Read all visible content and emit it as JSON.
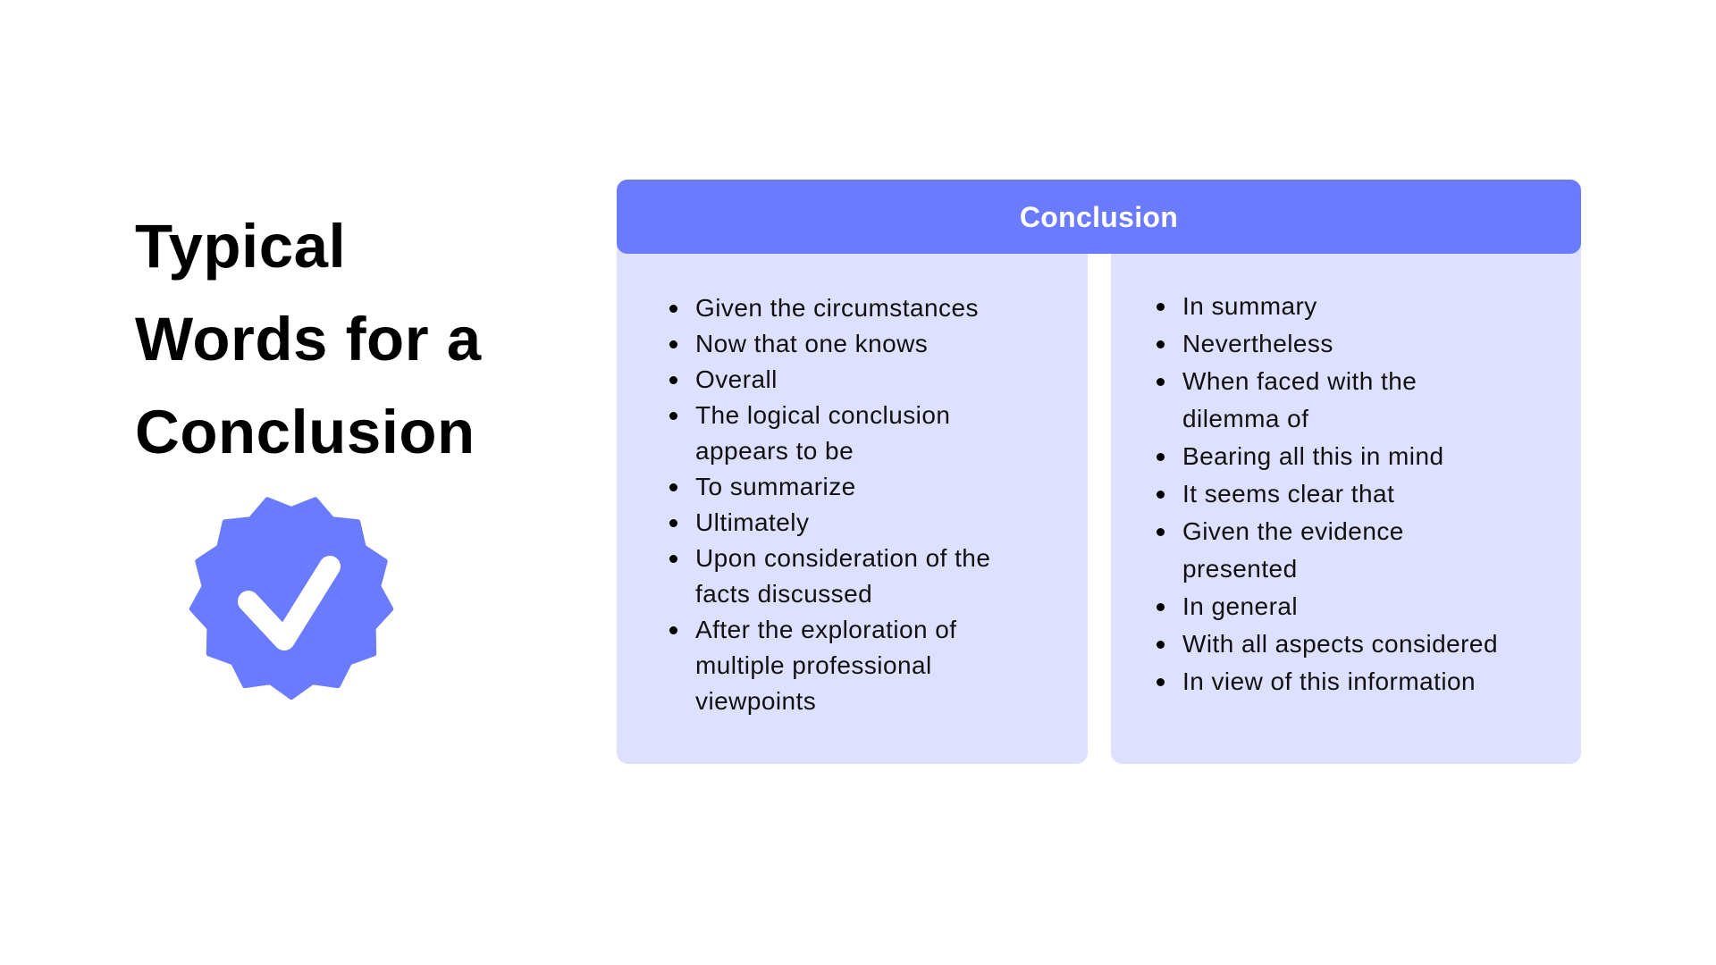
{
  "page": {
    "title_lines": [
      "Typical",
      "Words for a",
      "Conclusion"
    ],
    "badge_icon": "verified-check-badge-icon"
  },
  "table": {
    "header": "Conclusion",
    "left_column": [
      [
        "Given the circumstances"
      ],
      [
        "Now that one knows"
      ],
      [
        "Overall"
      ],
      [
        "The logical conclusion",
        "appears to be"
      ],
      [
        "To summarize"
      ],
      [
        "Ultimately"
      ],
      [
        "Upon consideration of the",
        "facts discussed"
      ],
      [
        "After the exploration of",
        "multiple professional",
        "viewpoints"
      ]
    ],
    "right_column": [
      [
        "In summary"
      ],
      [
        "Nevertheless"
      ],
      [
        "When faced with the",
        "dilemma of"
      ],
      [
        "Bearing all this in mind"
      ],
      [
        "It seems clear that"
      ],
      [
        "Given the evidence",
        "presented"
      ],
      [
        "In general"
      ],
      [
        "With all aspects considered"
      ],
      [
        "In view of this information"
      ]
    ]
  },
  "colors": {
    "accent": "#6b7bff",
    "card_background": "#dee0ff",
    "text": "#000000",
    "header_text": "#ffffff"
  }
}
